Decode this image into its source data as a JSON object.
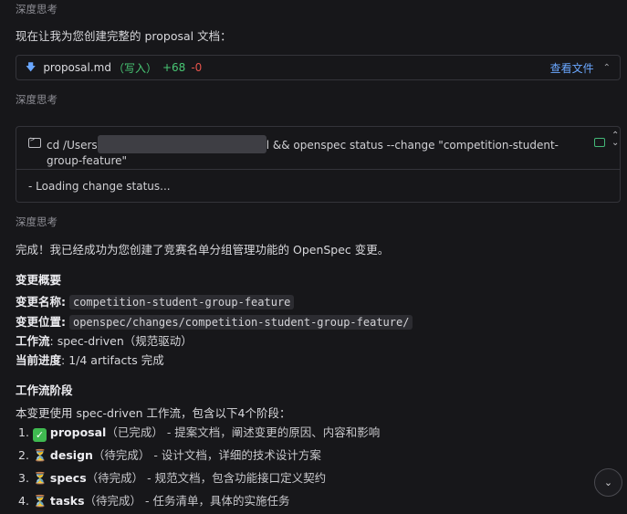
{
  "thinking_label": "深度思考",
  "intro": "现在让我为您创建完整的 proposal 文档：",
  "file_bar": {
    "filename": "proposal.md",
    "mode": "（写入）",
    "added": "+68",
    "removed": "-0",
    "view_label": "查看文件"
  },
  "terminal": {
    "cmd_prefix": "cd /Users",
    "cmd_suffix": "l && openspec status --change \"competition-student-",
    "cmd_line2": "group-feature\"",
    "output": "- Loading change status..."
  },
  "done_message": "完成！我已经成功为您创建了竞赛名单分组管理功能的 OpenSpec 变更。",
  "overview": {
    "heading": "变更概要",
    "name_label": "变更名称:",
    "name_value": "competition-student-group-feature",
    "location_label": "变更位置:",
    "location_value": "openspec/changes/competition-student-group-feature/",
    "workflow_label": "工作流",
    "workflow_value": ": spec-driven（规范驱动）",
    "progress_label": "当前进度",
    "progress_value": ": 1/4 artifacts 完成"
  },
  "phases": {
    "heading": "工作流阶段",
    "intro": "本变更使用 spec-driven 工作流，包含以下4个阶段：",
    "items": [
      {
        "num": "1.",
        "name": "proposal",
        "status": "（已完成）",
        "desc": " - 提案文档，阐述变更的原因、内容和影响",
        "icon": "check-icon"
      },
      {
        "num": "2.",
        "name": "design",
        "status": "（待完成）",
        "desc": " - 设计文档，详细的技术设计方案",
        "icon": "hourglass-icon"
      },
      {
        "num": "3.",
        "name": "specs",
        "status": "（待完成）",
        "desc": " - 规范文档，包含功能接口定义契约",
        "icon": "hourglass-icon"
      },
      {
        "num": "4.",
        "name": "tasks",
        "status": "（待完成）",
        "desc": " - 任务清单，具体的实施任务",
        "icon": "hourglass-icon"
      }
    ]
  },
  "colors": {
    "background": "#17171a",
    "link": "#6aa7ff",
    "added": "#48c774",
    "removed": "#e5534b"
  }
}
